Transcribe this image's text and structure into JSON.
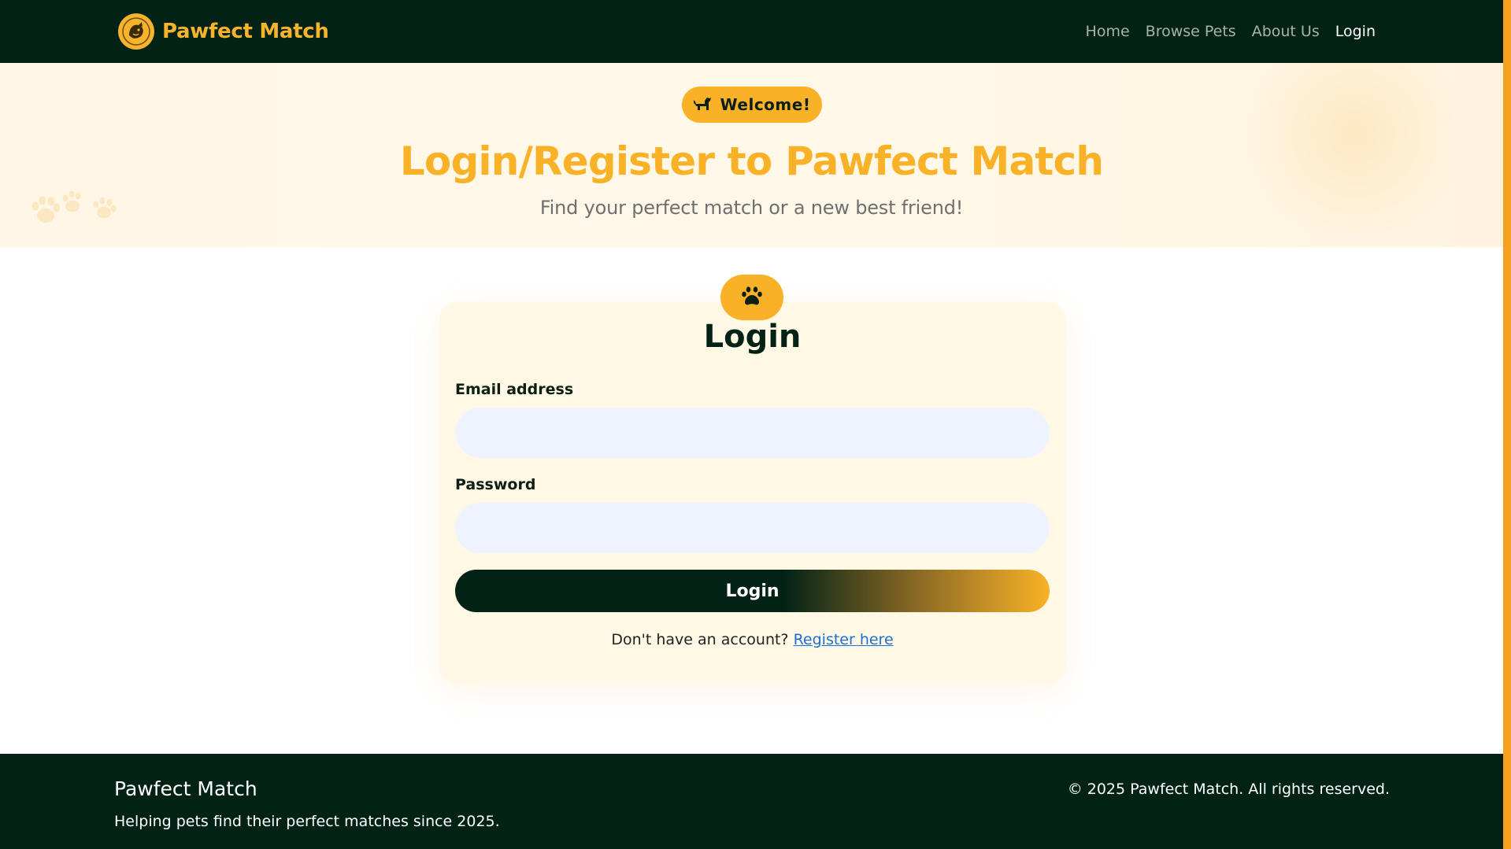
{
  "navbar": {
    "brand": "Pawfect Match",
    "logo_icon": "dog-logo-icon",
    "links": [
      {
        "label": "Home",
        "active": false
      },
      {
        "label": "Browse Pets",
        "active": false
      },
      {
        "label": "About Us",
        "active": false
      },
      {
        "label": "Login",
        "active": true
      }
    ]
  },
  "hero": {
    "badge_icon": "dog-icon",
    "badge_label": "Welcome!",
    "title": "Login/Register to Pawfect Match",
    "subtitle": "Find your perfect match or a new best friend!"
  },
  "login_card": {
    "icon": "paw-icon",
    "title": "Login",
    "email_label": "Email address",
    "email_value": "",
    "password_label": "Password",
    "password_value": "",
    "submit_label": "Login",
    "register_prompt": "Don't have an account?",
    "register_link": "Register here"
  },
  "footer": {
    "brand": "Pawfect Match",
    "tagline": "Helping pets find their perfect matches since 2025.",
    "copyright": "© 2025 Pawfect Match. All rights reserved."
  },
  "colors": {
    "dark": "#022216",
    "accent": "#f9b227",
    "hero_bg": "#fff6e6",
    "card_bg": "#fff8e4",
    "input_bg": "#eef3ff",
    "link": "#1d6fd6"
  }
}
